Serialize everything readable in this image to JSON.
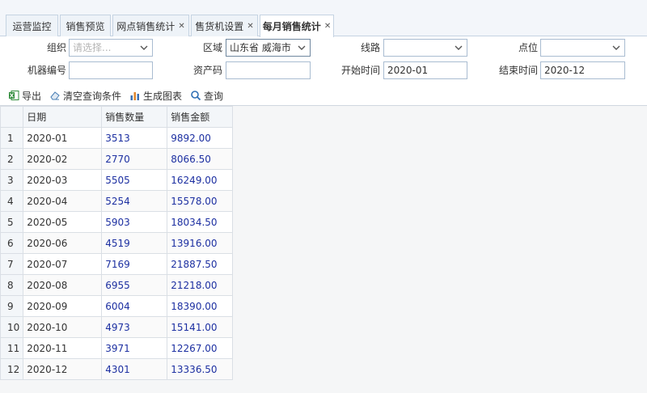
{
  "tabs": [
    {
      "label": "运营监控",
      "closable": false,
      "active": false
    },
    {
      "label": "销售预览",
      "closable": false,
      "active": false
    },
    {
      "label": "网点销售统计",
      "closable": true,
      "active": false
    },
    {
      "label": "售货机设置",
      "closable": true,
      "active": false
    },
    {
      "label": "每月销售统计",
      "closable": true,
      "active": true
    }
  ],
  "filters": {
    "org": {
      "label": "组织",
      "placeholder": "请选择..."
    },
    "region": {
      "label": "区域",
      "value": "山东省 威海市 "
    },
    "route": {
      "label": "线路",
      "value": ""
    },
    "point": {
      "label": "点位",
      "value": ""
    },
    "machine_no": {
      "label": "机器编号",
      "value": ""
    },
    "asset_code": {
      "label": "资产码",
      "value": ""
    },
    "start_time": {
      "label": "开始时间",
      "value": "2020-01"
    },
    "end_time": {
      "label": "结束时间",
      "value": "2020-12"
    }
  },
  "toolbar": {
    "export": "导出",
    "clear": "清空查询条件",
    "chart": "生成图表",
    "query": "查询"
  },
  "table": {
    "headers": [
      "日期",
      "销售数量",
      "销售金额"
    ],
    "rows": [
      {
        "no": "1",
        "date": "2020-01",
        "qty": "3513",
        "amount": "9892.00"
      },
      {
        "no": "2",
        "date": "2020-02",
        "qty": "2770",
        "amount": "8066.50"
      },
      {
        "no": "3",
        "date": "2020-03",
        "qty": "5505",
        "amount": "16249.00"
      },
      {
        "no": "4",
        "date": "2020-04",
        "qty": "5254",
        "amount": "15578.00"
      },
      {
        "no": "5",
        "date": "2020-05",
        "qty": "5903",
        "amount": "18034.50"
      },
      {
        "no": "6",
        "date": "2020-06",
        "qty": "4519",
        "amount": "13916.00"
      },
      {
        "no": "7",
        "date": "2020-07",
        "qty": "7169",
        "amount": "21887.50"
      },
      {
        "no": "8",
        "date": "2020-08",
        "qty": "6955",
        "amount": "21218.00"
      },
      {
        "no": "9",
        "date": "2020-09",
        "qty": "6004",
        "amount": "18390.00"
      },
      {
        "no": "10",
        "date": "2020-10",
        "qty": "4973",
        "amount": "15141.00"
      },
      {
        "no": "11",
        "date": "2020-11",
        "qty": "3971",
        "amount": "12267.00"
      },
      {
        "no": "12",
        "date": "2020-12",
        "qty": "4301",
        "amount": "13336.50"
      }
    ]
  },
  "icons": {
    "export": "excel-icon",
    "clear": "eraser-icon",
    "chart": "bar-chart-icon",
    "query": "search-icon",
    "dropdown": "chevron-down-icon",
    "close": "close-icon"
  },
  "colors": {
    "number_text": "#1c2fa1",
    "field_border": "#a9bcd1",
    "tab_border": "#c5d3e2"
  }
}
